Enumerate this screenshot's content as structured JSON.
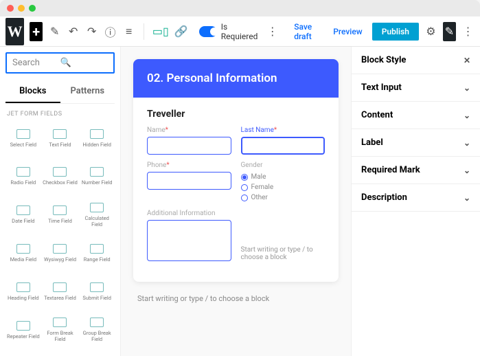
{
  "toolbar": {
    "toggle_label": "Is Requiered",
    "save_draft": "Save draft",
    "preview": "Preview",
    "publish": "Publish"
  },
  "inserter": {
    "search_placeholder": "Search",
    "tab_blocks": "Blocks",
    "tab_patterns": "Patterns",
    "section_title": "JET FORM FIELDS",
    "blocks": [
      "Select Field",
      "Text Field",
      "Hidden Field",
      "Radio Field",
      "Checkbox Field",
      "Number Field",
      "Date Field",
      "Time Field",
      "Calculated Field",
      "Media Field",
      "Wysiwyg Field",
      "Range Field",
      "Heading Field",
      "Textarea Field",
      "Submit Field",
      "Repeater Field",
      "Form Break Field",
      "Group Break Field"
    ]
  },
  "form": {
    "header": "02. Personal Information",
    "group_title": "Treveller",
    "name_label": "Name",
    "lastname_label": "Last Name",
    "phone_label": "Phone",
    "gender_label": "Gender",
    "gender_opts": [
      "Male",
      "Female",
      "Other"
    ],
    "additional_label": "Additional Information",
    "block_hint": "Start writing or type / to choose a block"
  },
  "canvas_hint": "Start writing or type / to choose a block",
  "sidebar": {
    "block_style": "Block Style",
    "panels": [
      "Text Input",
      "Content",
      "Label",
      "Required Mark",
      "Description"
    ]
  }
}
